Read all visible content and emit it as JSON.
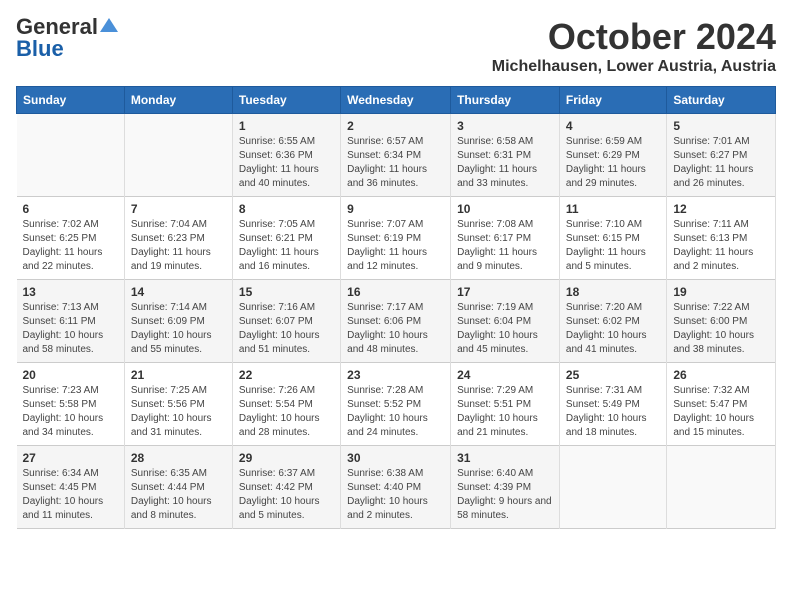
{
  "logo": {
    "general": "General",
    "blue": "Blue"
  },
  "title": "October 2024",
  "location": "Michelhausen, Lower Austria, Austria",
  "headers": [
    "Sunday",
    "Monday",
    "Tuesday",
    "Wednesday",
    "Thursday",
    "Friday",
    "Saturday"
  ],
  "weeks": [
    [
      {
        "day": "",
        "detail": ""
      },
      {
        "day": "",
        "detail": ""
      },
      {
        "day": "1",
        "detail": "Sunrise: 6:55 AM\nSunset: 6:36 PM\nDaylight: 11 hours and 40 minutes."
      },
      {
        "day": "2",
        "detail": "Sunrise: 6:57 AM\nSunset: 6:34 PM\nDaylight: 11 hours and 36 minutes."
      },
      {
        "day": "3",
        "detail": "Sunrise: 6:58 AM\nSunset: 6:31 PM\nDaylight: 11 hours and 33 minutes."
      },
      {
        "day": "4",
        "detail": "Sunrise: 6:59 AM\nSunset: 6:29 PM\nDaylight: 11 hours and 29 minutes."
      },
      {
        "day": "5",
        "detail": "Sunrise: 7:01 AM\nSunset: 6:27 PM\nDaylight: 11 hours and 26 minutes."
      }
    ],
    [
      {
        "day": "6",
        "detail": "Sunrise: 7:02 AM\nSunset: 6:25 PM\nDaylight: 11 hours and 22 minutes."
      },
      {
        "day": "7",
        "detail": "Sunrise: 7:04 AM\nSunset: 6:23 PM\nDaylight: 11 hours and 19 minutes."
      },
      {
        "day": "8",
        "detail": "Sunrise: 7:05 AM\nSunset: 6:21 PM\nDaylight: 11 hours and 16 minutes."
      },
      {
        "day": "9",
        "detail": "Sunrise: 7:07 AM\nSunset: 6:19 PM\nDaylight: 11 hours and 12 minutes."
      },
      {
        "day": "10",
        "detail": "Sunrise: 7:08 AM\nSunset: 6:17 PM\nDaylight: 11 hours and 9 minutes."
      },
      {
        "day": "11",
        "detail": "Sunrise: 7:10 AM\nSunset: 6:15 PM\nDaylight: 11 hours and 5 minutes."
      },
      {
        "day": "12",
        "detail": "Sunrise: 7:11 AM\nSunset: 6:13 PM\nDaylight: 11 hours and 2 minutes."
      }
    ],
    [
      {
        "day": "13",
        "detail": "Sunrise: 7:13 AM\nSunset: 6:11 PM\nDaylight: 10 hours and 58 minutes."
      },
      {
        "day": "14",
        "detail": "Sunrise: 7:14 AM\nSunset: 6:09 PM\nDaylight: 10 hours and 55 minutes."
      },
      {
        "day": "15",
        "detail": "Sunrise: 7:16 AM\nSunset: 6:07 PM\nDaylight: 10 hours and 51 minutes."
      },
      {
        "day": "16",
        "detail": "Sunrise: 7:17 AM\nSunset: 6:06 PM\nDaylight: 10 hours and 48 minutes."
      },
      {
        "day": "17",
        "detail": "Sunrise: 7:19 AM\nSunset: 6:04 PM\nDaylight: 10 hours and 45 minutes."
      },
      {
        "day": "18",
        "detail": "Sunrise: 7:20 AM\nSunset: 6:02 PM\nDaylight: 10 hours and 41 minutes."
      },
      {
        "day": "19",
        "detail": "Sunrise: 7:22 AM\nSunset: 6:00 PM\nDaylight: 10 hours and 38 minutes."
      }
    ],
    [
      {
        "day": "20",
        "detail": "Sunrise: 7:23 AM\nSunset: 5:58 PM\nDaylight: 10 hours and 34 minutes."
      },
      {
        "day": "21",
        "detail": "Sunrise: 7:25 AM\nSunset: 5:56 PM\nDaylight: 10 hours and 31 minutes."
      },
      {
        "day": "22",
        "detail": "Sunrise: 7:26 AM\nSunset: 5:54 PM\nDaylight: 10 hours and 28 minutes."
      },
      {
        "day": "23",
        "detail": "Sunrise: 7:28 AM\nSunset: 5:52 PM\nDaylight: 10 hours and 24 minutes."
      },
      {
        "day": "24",
        "detail": "Sunrise: 7:29 AM\nSunset: 5:51 PM\nDaylight: 10 hours and 21 minutes."
      },
      {
        "day": "25",
        "detail": "Sunrise: 7:31 AM\nSunset: 5:49 PM\nDaylight: 10 hours and 18 minutes."
      },
      {
        "day": "26",
        "detail": "Sunrise: 7:32 AM\nSunset: 5:47 PM\nDaylight: 10 hours and 15 minutes."
      }
    ],
    [
      {
        "day": "27",
        "detail": "Sunrise: 6:34 AM\nSunset: 4:45 PM\nDaylight: 10 hours and 11 minutes."
      },
      {
        "day": "28",
        "detail": "Sunrise: 6:35 AM\nSunset: 4:44 PM\nDaylight: 10 hours and 8 minutes."
      },
      {
        "day": "29",
        "detail": "Sunrise: 6:37 AM\nSunset: 4:42 PM\nDaylight: 10 hours and 5 minutes."
      },
      {
        "day": "30",
        "detail": "Sunrise: 6:38 AM\nSunset: 4:40 PM\nDaylight: 10 hours and 2 minutes."
      },
      {
        "day": "31",
        "detail": "Sunrise: 6:40 AM\nSunset: 4:39 PM\nDaylight: 9 hours and 58 minutes."
      },
      {
        "day": "",
        "detail": ""
      },
      {
        "day": "",
        "detail": ""
      }
    ]
  ]
}
